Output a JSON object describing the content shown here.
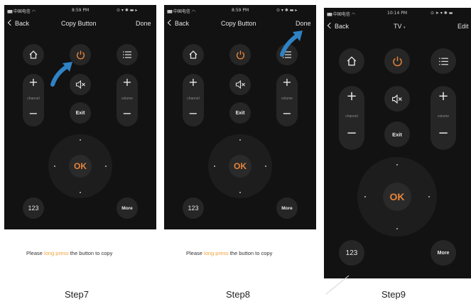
{
  "screens": [
    {
      "status": {
        "carrier": "中国电信",
        "time": "8:59 PM"
      },
      "nav": {
        "back": "Back",
        "title": "Copy Button",
        "done": "Done"
      },
      "remote": {
        "channel": "channel",
        "volume": "volume",
        "exit": "Exit",
        "ok": "OK",
        "num": "123",
        "more": "More"
      }
    },
    {
      "status": {
        "carrier": "中国电信",
        "time": "8:59 PM"
      },
      "nav": {
        "back": "Back",
        "title": "Copy Button",
        "done": "Done"
      },
      "remote": {
        "channel": "channel",
        "volume": "volume",
        "exit": "Exit",
        "ok": "OK",
        "num": "123",
        "more": "More"
      }
    },
    {
      "status": {
        "carrier": "中国电信",
        "time": "10:14 PM"
      },
      "nav": {
        "back": "Back",
        "title": "TV",
        "edit": "Edit"
      },
      "remote": {
        "channel": "channel",
        "volume": "volume",
        "exit": "Exit",
        "ok": "OK",
        "num": "123",
        "more": "More"
      }
    }
  ],
  "instructions": [
    {
      "before": "Please ",
      "highlight": "long press",
      "after": " the button to copy"
    },
    {
      "before": "Please ",
      "highlight": "long press",
      "after": " the button to copy"
    }
  ],
  "steps": [
    "Step7",
    "Step8",
    "Step9"
  ],
  "colors": {
    "accent_orange": "#e8853a",
    "highlight": "#f0a236",
    "arrow_blue": "#2f82c4",
    "screen_bg": "#121212",
    "button_bg": "#262626"
  }
}
